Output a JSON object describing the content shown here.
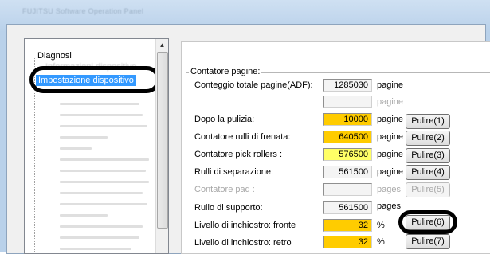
{
  "window": {
    "title": "FUJITSU Software Operation Panel"
  },
  "tree": {
    "root_label": "Diagnosi",
    "faded_item": "Informazioni dispositivo",
    "selected_item": "Impostazione dispositivo"
  },
  "counter_group": {
    "title": "Contatore pagine:",
    "rows": [
      {
        "label": "Conteggio totale pagine(ADF):",
        "value": "1285030",
        "unit": "pagine",
        "button": ""
      },
      {
        "label": "",
        "value": "",
        "unit": "pagine",
        "button": ""
      },
      {
        "label": "Dopo la pulizia:",
        "value": "10000",
        "unit": "pagine",
        "button": "Pulire(1)"
      },
      {
        "label": "Contatore rulli di frenata:",
        "value": "640500",
        "unit": "pagine",
        "button": "Pulire(2)"
      },
      {
        "label": "Contatore pick rollers :",
        "value": "576500",
        "unit": "pagine",
        "button": "Pulire(3)"
      },
      {
        "label": "Rulli di separazione:",
        "value": "561500",
        "unit": "pagine",
        "button": "Pulire(4)"
      },
      {
        "label": "Contatore pad :",
        "value": "",
        "unit": "pages",
        "button": "Pulire(5)"
      },
      {
        "label": "Rullo di supporto:",
        "value": "561500",
        "unit": "pages",
        "button": ""
      },
      {
        "label": "Livello di inchiostro: fronte",
        "value": "32",
        "unit": "%",
        "button": "Pulire(6)"
      },
      {
        "label": "Livello di inchiostro: retro",
        "value": "32",
        "unit": "%",
        "button": "Pulire(7)"
      }
    ]
  },
  "colors": {
    "warning_yellow": "#ffcc00",
    "light_yellow": "#ffff66",
    "selection_blue": "#3399ff"
  }
}
